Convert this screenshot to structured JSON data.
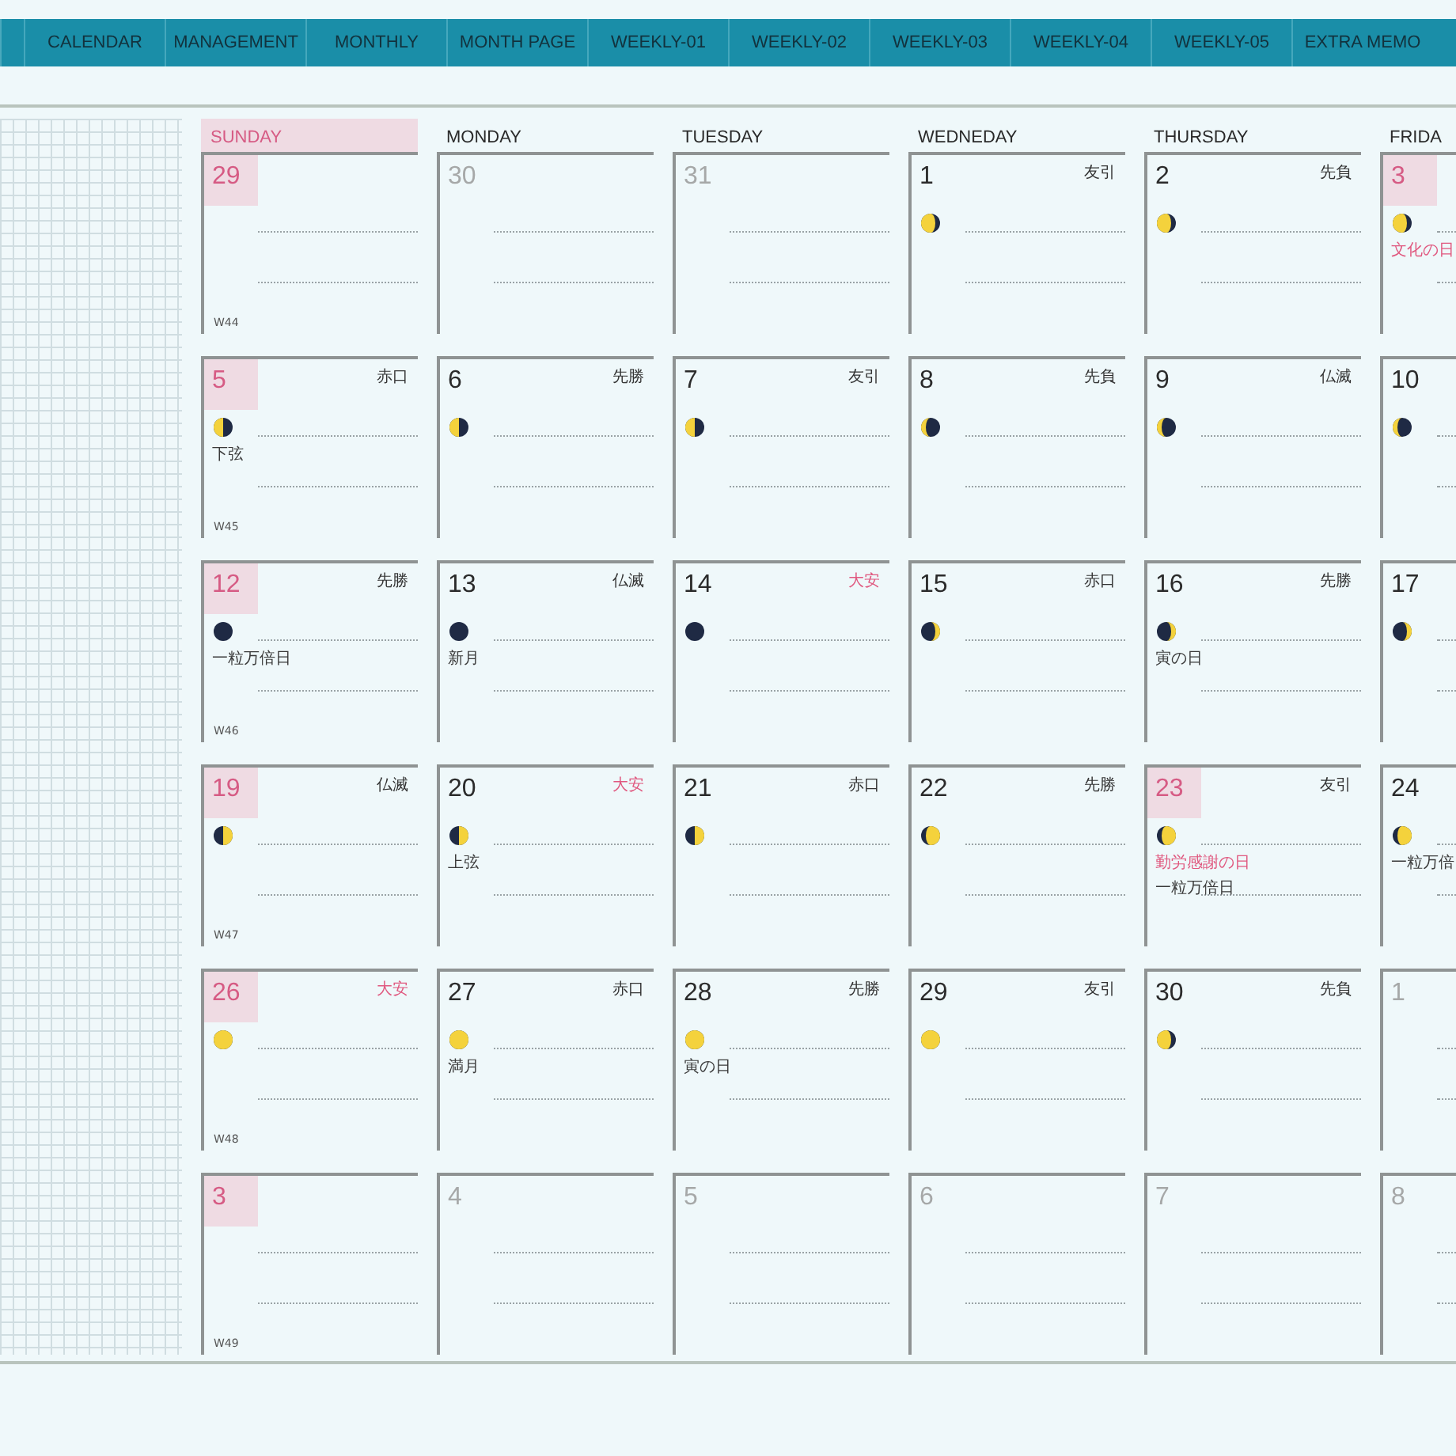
{
  "nav": {
    "tabs": [
      {
        "label": "CALENDAR"
      },
      {
        "label": "MANAGEMENT"
      },
      {
        "label": "MONTHLY"
      },
      {
        "label": "MONTH PAGE"
      },
      {
        "label": "WEEKLY-01"
      },
      {
        "label": "WEEKLY-02"
      },
      {
        "label": "WEEKLY-03"
      },
      {
        "label": "WEEKLY-04"
      },
      {
        "label": "WEEKLY-05"
      },
      {
        "label": "EXTRA MEMO"
      }
    ]
  },
  "weekdays": [
    {
      "label": "SUNDAY",
      "highlight": true
    },
    {
      "label": "MONDAY",
      "highlight": false
    },
    {
      "label": "TUESDAY",
      "highlight": false
    },
    {
      "label": "WEDNEDAY",
      "highlight": false
    },
    {
      "label": "THURSDAY",
      "highlight": false
    },
    {
      "label": "FRIDA",
      "highlight": false
    }
  ],
  "weeks": [
    [
      {
        "date": "29",
        "other": true,
        "highlight": true,
        "week": "W44"
      },
      {
        "date": "30",
        "other": true,
        "highlight": false
      },
      {
        "date": "31",
        "other": true,
        "highlight": false
      },
      {
        "date": "1",
        "other": false,
        "highlight": false,
        "rokuyo": {
          "text": "友引",
          "red": false
        },
        "moon": {
          "kind": "waning-gibbous"
        }
      },
      {
        "date": "2",
        "other": false,
        "highlight": false,
        "rokuyo": {
          "text": "先負",
          "red": false
        },
        "moon": {
          "kind": "waning-gibbous"
        }
      },
      {
        "date": "3",
        "other": false,
        "highlight": true,
        "moon": {
          "kind": "waning-gibbous"
        },
        "notes": [
          {
            "text": "文化の日",
            "red": true
          }
        ]
      }
    ],
    [
      {
        "date": "5",
        "other": false,
        "highlight": true,
        "week": "W45",
        "rokuyo": {
          "text": "赤口",
          "red": false
        },
        "moon": {
          "kind": "last-quarter"
        },
        "notes": [
          {
            "text": "下弦",
            "red": false
          }
        ]
      },
      {
        "date": "6",
        "other": false,
        "highlight": false,
        "rokuyo": {
          "text": "先勝",
          "red": false
        },
        "moon": {
          "kind": "last-quarter"
        }
      },
      {
        "date": "7",
        "other": false,
        "highlight": false,
        "rokuyo": {
          "text": "友引",
          "red": false
        },
        "moon": {
          "kind": "last-quarter"
        }
      },
      {
        "date": "8",
        "other": false,
        "highlight": false,
        "rokuyo": {
          "text": "先負",
          "red": false
        },
        "moon": {
          "kind": "waning-crescent"
        }
      },
      {
        "date": "9",
        "other": false,
        "highlight": false,
        "rokuyo": {
          "text": "仏滅",
          "red": false
        },
        "moon": {
          "kind": "waning-crescent"
        }
      },
      {
        "date": "10",
        "other": false,
        "highlight": false,
        "moon": {
          "kind": "waning-crescent"
        }
      }
    ],
    [
      {
        "date": "12",
        "other": false,
        "highlight": true,
        "week": "W46",
        "rokuyo": {
          "text": "先勝",
          "red": false
        },
        "moon": {
          "kind": "new"
        },
        "notes": [
          {
            "text": "一粒万倍日",
            "red": false
          }
        ]
      },
      {
        "date": "13",
        "other": false,
        "highlight": false,
        "rokuyo": {
          "text": "仏滅",
          "red": false
        },
        "moon": {
          "kind": "new"
        },
        "notes": [
          {
            "text": "新月",
            "red": false
          }
        ]
      },
      {
        "date": "14",
        "other": false,
        "highlight": false,
        "rokuyo": {
          "text": "大安",
          "red": true
        },
        "moon": {
          "kind": "new"
        }
      },
      {
        "date": "15",
        "other": false,
        "highlight": false,
        "rokuyo": {
          "text": "赤口",
          "red": false
        },
        "moon": {
          "kind": "waxing-crescent"
        }
      },
      {
        "date": "16",
        "other": false,
        "highlight": false,
        "rokuyo": {
          "text": "先勝",
          "red": false
        },
        "moon": {
          "kind": "waxing-crescent"
        },
        "notes": [
          {
            "text": "寅の日",
            "red": false
          }
        ]
      },
      {
        "date": "17",
        "other": false,
        "highlight": false,
        "moon": {
          "kind": "waxing-crescent"
        }
      }
    ],
    [
      {
        "date": "19",
        "other": false,
        "highlight": true,
        "week": "W47",
        "rokuyo": {
          "text": "仏滅",
          "red": false
        },
        "moon": {
          "kind": "first-quarter"
        }
      },
      {
        "date": "20",
        "other": false,
        "highlight": false,
        "rokuyo": {
          "text": "大安",
          "red": true
        },
        "moon": {
          "kind": "first-quarter"
        },
        "notes": [
          {
            "text": "上弦",
            "red": false
          }
        ]
      },
      {
        "date": "21",
        "other": false,
        "highlight": false,
        "rokuyo": {
          "text": "赤口",
          "red": false
        },
        "moon": {
          "kind": "first-quarter"
        }
      },
      {
        "date": "22",
        "other": false,
        "highlight": false,
        "rokuyo": {
          "text": "先勝",
          "red": false
        },
        "moon": {
          "kind": "waxing-gibbous"
        }
      },
      {
        "date": "23",
        "other": false,
        "highlight": true,
        "rokuyo": {
          "text": "友引",
          "red": false
        },
        "moon": {
          "kind": "waxing-gibbous"
        },
        "notes": [
          {
            "text": "勤労感謝の日",
            "red": true
          },
          {
            "text": "一粒万倍日",
            "red": false
          }
        ]
      },
      {
        "date": "24",
        "other": false,
        "highlight": false,
        "moon": {
          "kind": "waxing-gibbous"
        },
        "notes": [
          {
            "text": "一粒万倍",
            "red": false
          }
        ]
      }
    ],
    [
      {
        "date": "26",
        "other": false,
        "highlight": true,
        "week": "W48",
        "rokuyo": {
          "text": "大安",
          "red": true
        },
        "moon": {
          "kind": "full"
        }
      },
      {
        "date": "27",
        "other": false,
        "highlight": false,
        "rokuyo": {
          "text": "赤口",
          "red": false
        },
        "moon": {
          "kind": "full"
        },
        "notes": [
          {
            "text": "満月",
            "red": false
          }
        ]
      },
      {
        "date": "28",
        "other": false,
        "highlight": false,
        "rokuyo": {
          "text": "先勝",
          "red": false
        },
        "moon": {
          "kind": "full"
        },
        "notes": [
          {
            "text": "寅の日",
            "red": false
          }
        ]
      },
      {
        "date": "29",
        "other": false,
        "highlight": false,
        "rokuyo": {
          "text": "友引",
          "red": false
        },
        "moon": {
          "kind": "full"
        }
      },
      {
        "date": "30",
        "other": false,
        "highlight": false,
        "rokuyo": {
          "text": "先負",
          "red": false
        },
        "moon": {
          "kind": "waning-gibbous"
        }
      },
      {
        "date": "1",
        "other": true,
        "highlight": false
      }
    ],
    [
      {
        "date": "3",
        "other": true,
        "highlight": true,
        "week": "W49"
      },
      {
        "date": "4",
        "other": true,
        "highlight": false
      },
      {
        "date": "5",
        "other": true,
        "highlight": false
      },
      {
        "date": "6",
        "other": true,
        "highlight": false
      },
      {
        "date": "7",
        "other": true,
        "highlight": false
      },
      {
        "date": "8",
        "other": true,
        "highlight": false
      }
    ]
  ]
}
